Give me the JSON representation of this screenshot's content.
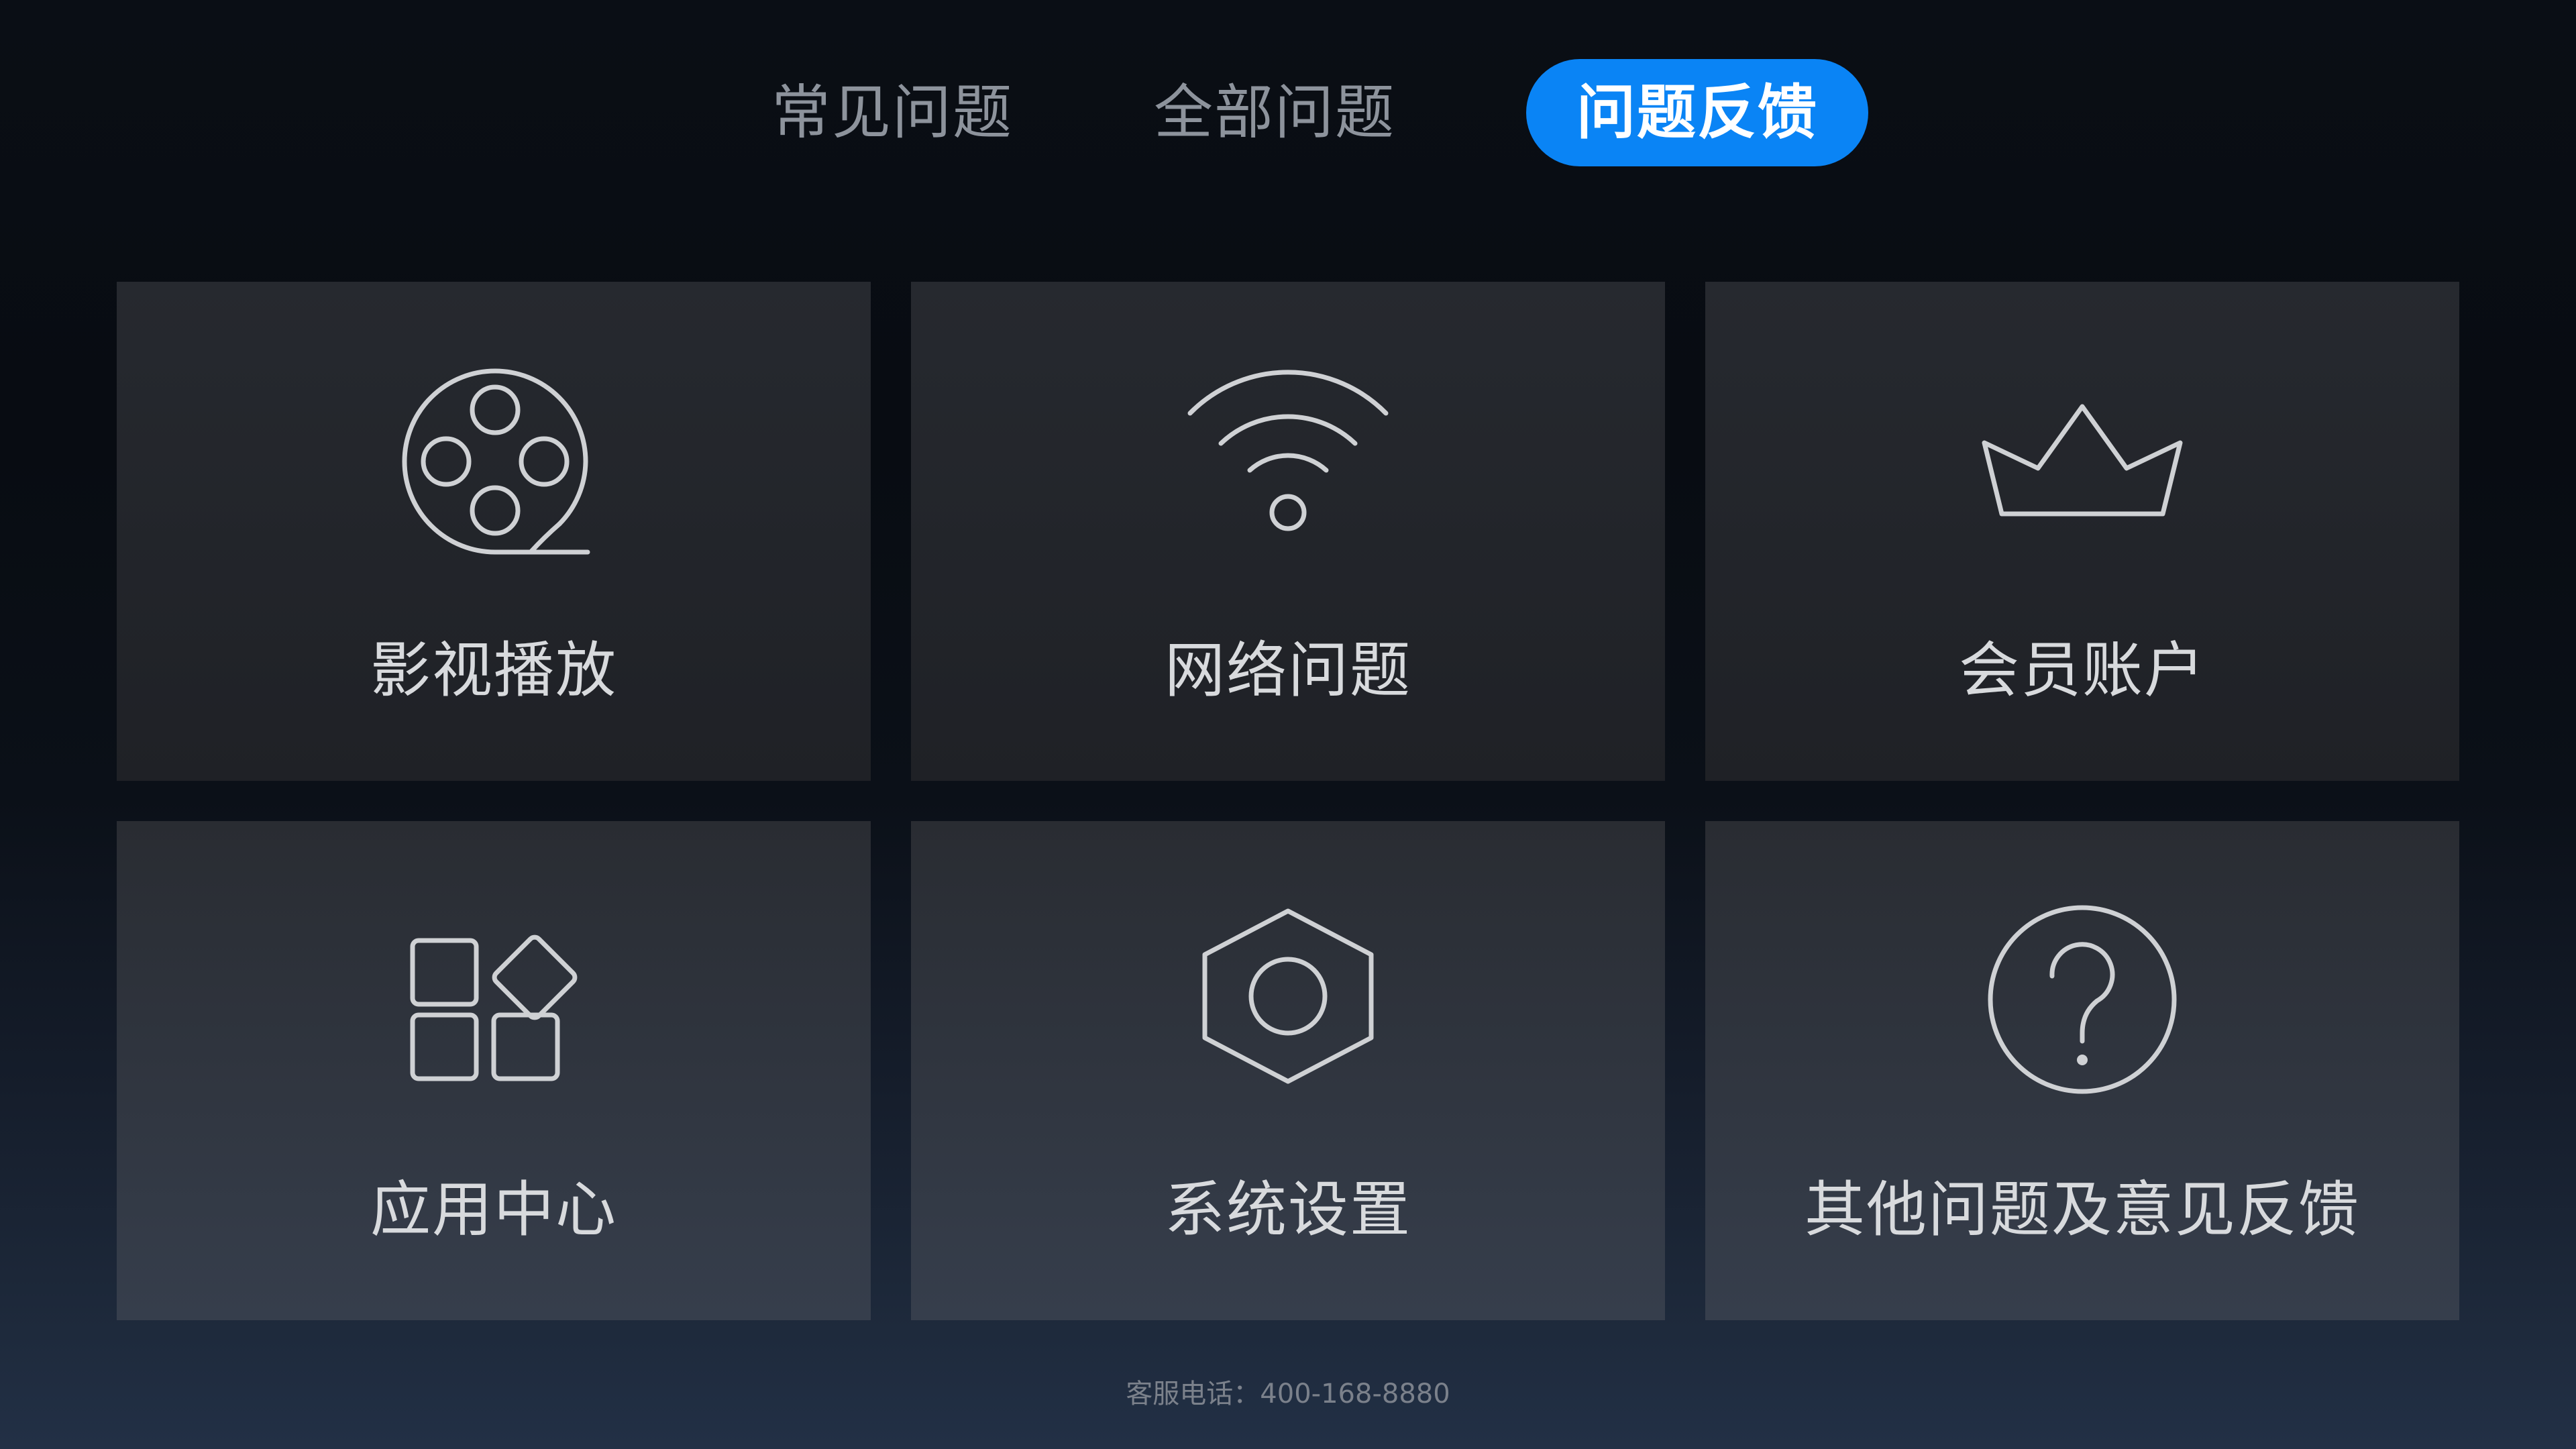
{
  "tabs": [
    {
      "label": "常见问题",
      "active": false
    },
    {
      "label": "全部问题",
      "active": false
    },
    {
      "label": "问题反馈",
      "active": true
    }
  ],
  "colors": {
    "accent": "#0a84f5",
    "tab_inactive": "#8d939c",
    "card_label": "#d8dadd",
    "icon_stroke": "#cfd1d4"
  },
  "cards": [
    {
      "label": "影视播放",
      "icon": "film-reel-icon"
    },
    {
      "label": "网络问题",
      "icon": "wifi-icon"
    },
    {
      "label": "会员账户",
      "icon": "crown-icon"
    },
    {
      "label": "应用中心",
      "icon": "apps-grid-icon"
    },
    {
      "label": "系统设置",
      "icon": "hexagon-nut-icon"
    },
    {
      "label": "其他问题及意见反馈",
      "icon": "question-circle-icon"
    }
  ],
  "footer": {
    "hotline": "客服电话：400-168-8880"
  }
}
